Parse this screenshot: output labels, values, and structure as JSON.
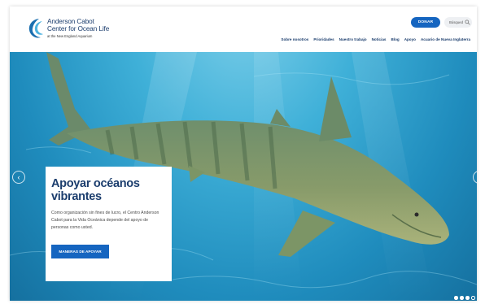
{
  "header": {
    "logo": {
      "line1": "Anderson Cabot",
      "line2": "Center for Ocean Life",
      "line3": "at the New England Aquarium"
    },
    "donate_label": "DONAR",
    "search_placeholder": "Búsqued",
    "nav": [
      {
        "label": "Sobre nosotros"
      },
      {
        "label": "Prioridades"
      },
      {
        "label": "Nuestro trabajo"
      },
      {
        "label": "Noticias"
      },
      {
        "label": "Blog"
      },
      {
        "label": "Apoyo"
      },
      {
        "label": "Acuario de Nueva Inglaterra"
      }
    ]
  },
  "hero": {
    "title": "Apoyar océanos vibrantes",
    "body": "Como organización sin fines de lucro, el Centro Anderson Cabot para la Vida Oceánica depende del apoyo de personas como usted.",
    "cta_label": "MANERAS DE APOYAR",
    "arrow_left": "‹",
    "arrow_right": "›",
    "slides": {
      "count": 4,
      "active": 3
    }
  },
  "colors": {
    "brand": "#1b3d6d",
    "accent": "#1565c0",
    "water": "#2a9fd0"
  },
  "icons": [
    "logo-wave-icon",
    "search-icon",
    "chevron-left-icon",
    "chevron-right-icon"
  ]
}
